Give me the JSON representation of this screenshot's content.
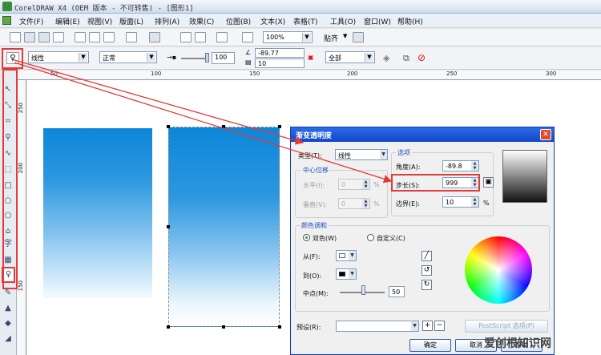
{
  "window": {
    "title": "CorelDRAW X4 (OEM 版本 - 不可转售) - [图形1]"
  },
  "menu": [
    "文件(F)",
    "编辑(E)",
    "视图(V)",
    "版面(L)",
    "排列(A)",
    "效果(C)",
    "位图(B)",
    "文本(X)",
    "表格(T)",
    "工具(O)",
    "窗口(W)",
    "帮助(H)"
  ],
  "toolbar": {
    "zoom": "100%",
    "snap_label": "贴齐"
  },
  "propbar": {
    "type": "线性",
    "mode": "正常",
    "value": "100",
    "angle": "-89.77",
    "step": "10",
    "target": "全部"
  },
  "ruler": {
    "h_ticks": [
      "50",
      "100",
      "150",
      "200",
      "250",
      "300"
    ],
    "v_ticks": [
      "250",
      "200",
      "150"
    ]
  },
  "toolbox": {
    "text_tool": "字"
  },
  "dialog": {
    "title": "渐变透明度",
    "type_label": "类型(T):",
    "type_value": "线性",
    "center_group": "中心位移",
    "h_label": "水平(I):",
    "h_value": "0",
    "v_label": "垂直(V):",
    "v_value": "0",
    "pct": "%",
    "options_group": "选项",
    "angle_label": "角度(A):",
    "angle_value": "-89.8",
    "step_label": "步长(S):",
    "step_value": "999",
    "edge_label": "边界(E):",
    "edge_value": "10",
    "color_group": "颜色调和",
    "two_color": "双色(W)",
    "custom": "自定义(C)",
    "from_label": "从(F):",
    "to_label": "到(O):",
    "mid_label": "中点(M):",
    "mid_value": "50",
    "preset_label": "预设(R):",
    "postscript": "PostScript 选项(P)",
    "ok": "确定",
    "cancel": "取消",
    "help": "帮助"
  },
  "watermark": "爱创根知识网",
  "colors": {
    "highlight": "#e53935",
    "title_bar": "#1f57d6",
    "gradient_top": "#0d86d8"
  }
}
